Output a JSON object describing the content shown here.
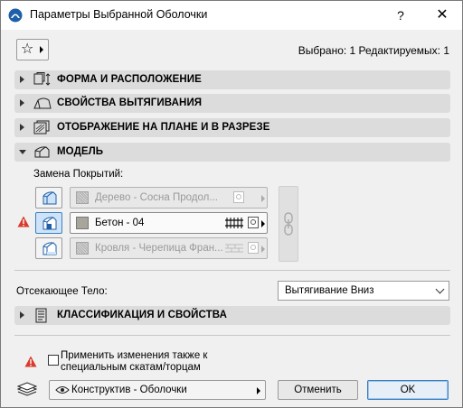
{
  "window": {
    "title": "Параметры Выбранной Оболочки",
    "help": "?",
    "close": "✕"
  },
  "header": {
    "favorites_icon": "star-icon",
    "selected_info": "Выбрано: 1 Редактируемых: 1"
  },
  "panels": [
    {
      "label": "ФОРМА И РАСПОЛОЖЕНИЕ",
      "expanded": false,
      "icon": "shape-position-icon"
    },
    {
      "label": "СВОЙСТВА ВЫТЯГИВАНИЯ",
      "expanded": false,
      "icon": "extrusion-icon"
    },
    {
      "label": "ОТОБРАЖЕНИЕ НА ПЛАНЕ И В РАЗРЕЗЕ",
      "expanded": false,
      "icon": "plan-section-icon"
    },
    {
      "label": "МОДЕЛЬ",
      "expanded": true,
      "icon": "model-icon"
    }
  ],
  "model": {
    "surface_override_label": "Замена Покрытий:",
    "surfaces": [
      {
        "name": "Дерево - Сосна Продол...",
        "enabled": false,
        "swatch": "pattern"
      },
      {
        "name": "Бетон - 04",
        "enabled": true,
        "swatch": "#a8a69a"
      },
      {
        "name": "Кровля - Черепица Фран...",
        "enabled": false,
        "swatch": "pattern"
      }
    ]
  },
  "cutting": {
    "label": "Отсекающее Тело:",
    "value": "Вытягивание Вниз"
  },
  "classification_panel": {
    "label": "КЛАССИФИКАЦИЯ И СВОЙСТВА",
    "expanded": false
  },
  "apply": {
    "line1": "Применить изменения также к",
    "line2": "специальным скатам/торцам",
    "checked": false
  },
  "footer": {
    "layer": "Конструктив - Оболочки",
    "cancel": "Отменить",
    "ok": "OK"
  },
  "colors": {
    "warning": "#d83b2b",
    "panel_bg": "#dcdcdc",
    "ok_border": "#3a7fc0"
  }
}
